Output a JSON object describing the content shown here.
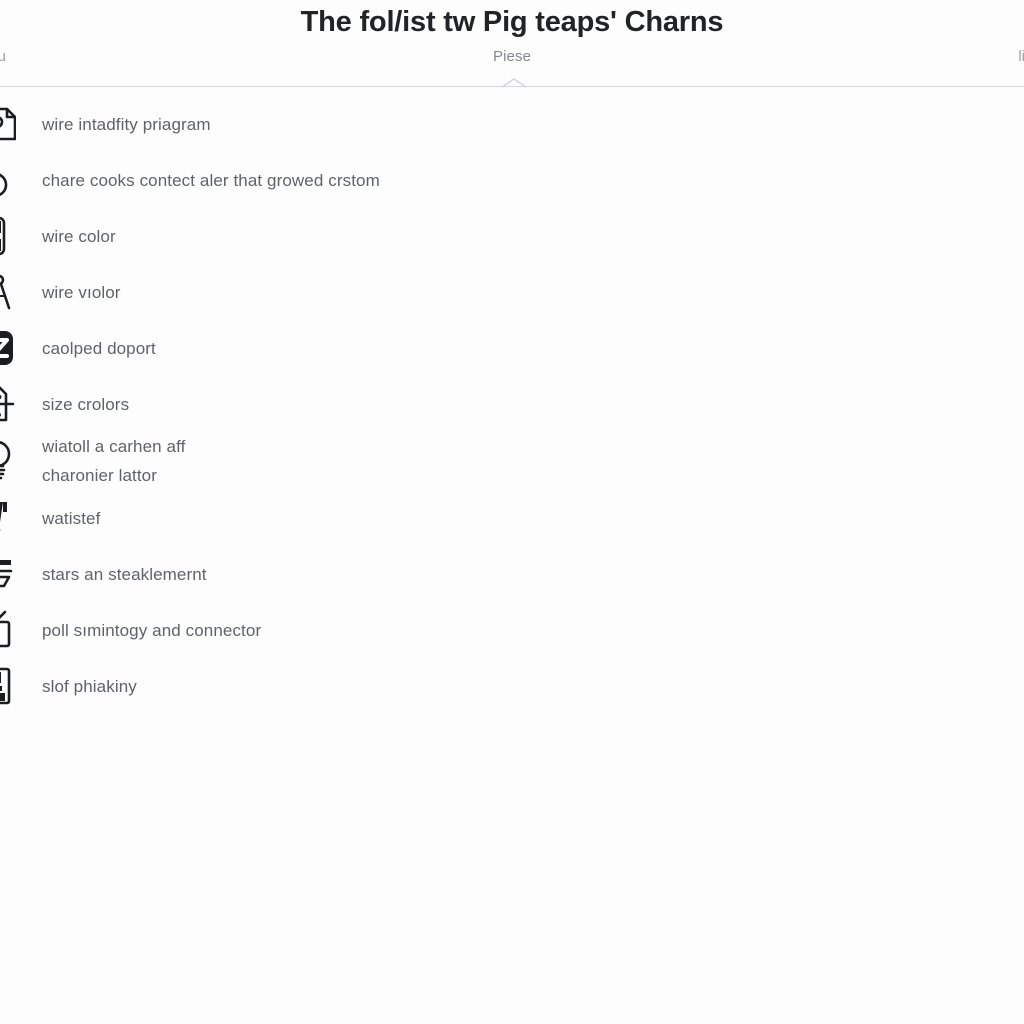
{
  "header": {
    "title": "The fol/ist tw Pig teaps' Charns",
    "subtitle": "Piese",
    "left_label": "elu",
    "right_label": "liitc",
    "divider_notch_icon": "chevron-up-icon"
  },
  "list": {
    "items": [
      {
        "label": "wire intadfity priagram",
        "icon": "document-icon"
      },
      {
        "label": "chare cooks contect aler that growed crstom",
        "icon": "spiral-icon"
      },
      {
        "label": "wire color",
        "icon": "fuse-icon"
      },
      {
        "label": "wire vıolor",
        "icon": "compass-icon"
      },
      {
        "label": "caolped doport",
        "icon": "z-badge-icon"
      },
      {
        "label": "size crolors",
        "icon": "birdhouse-post-icon"
      },
      {
        "label": "wiatoll a carhen aff\ncharonier lattor",
        "icon": "lightbulb-icon"
      },
      {
        "label": "watistef",
        "icon": "filled-bulb-icon"
      },
      {
        "label": "stars an steaklemernt",
        "icon": "tray-stack-icon"
      },
      {
        "label": "poll sımintogy and connector",
        "icon": "television-icon"
      },
      {
        "label": "slof phiakiny",
        "icon": "server-rack-icon"
      }
    ]
  },
  "colors": {
    "background": "#fdfdfd",
    "title": "#222326",
    "text": "#5f6368",
    "muted": "#9ea1a6",
    "divider": "#d4d6d9",
    "icon": "#1c1d20"
  }
}
